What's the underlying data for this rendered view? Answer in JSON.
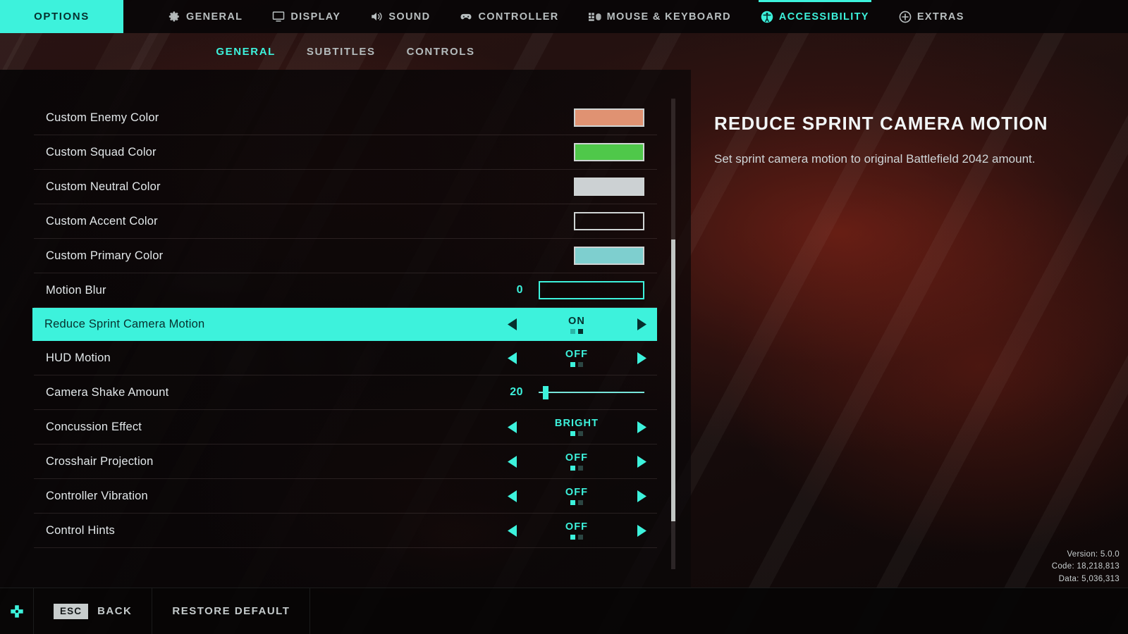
{
  "accent_color": "#3df2dc",
  "topnav": {
    "options_label": "OPTIONS",
    "items": [
      {
        "label": "GENERAL",
        "icon": "gear-icon",
        "active": false
      },
      {
        "label": "DISPLAY",
        "icon": "monitor-icon",
        "active": false
      },
      {
        "label": "SOUND",
        "icon": "speaker-icon",
        "active": false
      },
      {
        "label": "CONTROLLER",
        "icon": "gamepad-icon",
        "active": false
      },
      {
        "label": "MOUSE & KEYBOARD",
        "icon": "keyboard-icon",
        "active": false
      },
      {
        "label": "ACCESSIBILITY",
        "icon": "accessibility-icon",
        "active": true
      },
      {
        "label": "EXTRAS",
        "icon": "plus-circle-icon",
        "active": false
      }
    ]
  },
  "subtabs": [
    {
      "label": "GENERAL",
      "active": true
    },
    {
      "label": "SUBTITLES",
      "active": false
    },
    {
      "label": "CONTROLS",
      "active": false
    }
  ],
  "settings": [
    {
      "label": "Custom Enemy Color",
      "type": "swatch",
      "color": "#e09272"
    },
    {
      "label": "Custom Squad Color",
      "type": "swatch",
      "color": "#4fc84a"
    },
    {
      "label": "Custom Neutral Color",
      "type": "swatch",
      "color": "#ccd1d3"
    },
    {
      "label": "Custom Accent Color",
      "type": "swatch",
      "color": "#ddc council"
    },
    {
      "label": "Custom Primary Color",
      "type": "swatch",
      "color": "#7ecfcf"
    },
    {
      "label": "Motion Blur",
      "type": "slider_empty",
      "value": "0",
      "fill_pct": 0
    },
    {
      "label": "Reduce Sprint Camera Motion",
      "type": "stepper",
      "value": "ON",
      "dot_index": 1,
      "dot_count": 2,
      "selected": true
    },
    {
      "label": "HUD Motion",
      "type": "stepper",
      "value": "OFF",
      "dot_index": 0,
      "dot_count": 2
    },
    {
      "label": "Camera Shake Amount",
      "type": "slider",
      "value": "20",
      "fill_pct": 4
    },
    {
      "label": "Concussion Effect",
      "type": "stepper",
      "value": "BRIGHT",
      "dot_index": 0,
      "dot_count": 2
    },
    {
      "label": "Crosshair Projection",
      "type": "stepper",
      "value": "OFF",
      "dot_index": 0,
      "dot_count": 2
    },
    {
      "label": "Controller Vibration",
      "type": "stepper",
      "value": "OFF",
      "dot_index": 0,
      "dot_count": 2
    },
    {
      "label": "Control Hints",
      "type": "stepper",
      "value": "OFF",
      "dot_index": 0,
      "dot_count": 2
    }
  ],
  "detail": {
    "title": "REDUCE SPRINT CAMERA MOTION",
    "description": "Set sprint camera motion to original Battlefield 2042 amount."
  },
  "version_info": {
    "version": "Version: 5.0.0",
    "code": "Code: 18,218,813",
    "data": "Data: 5,036,313"
  },
  "bottombar": {
    "dpad_icon": "dpad-icon",
    "back_key": "ESC",
    "back_label": "BACK",
    "restore_label": "RESTORE DEFAULT"
  }
}
